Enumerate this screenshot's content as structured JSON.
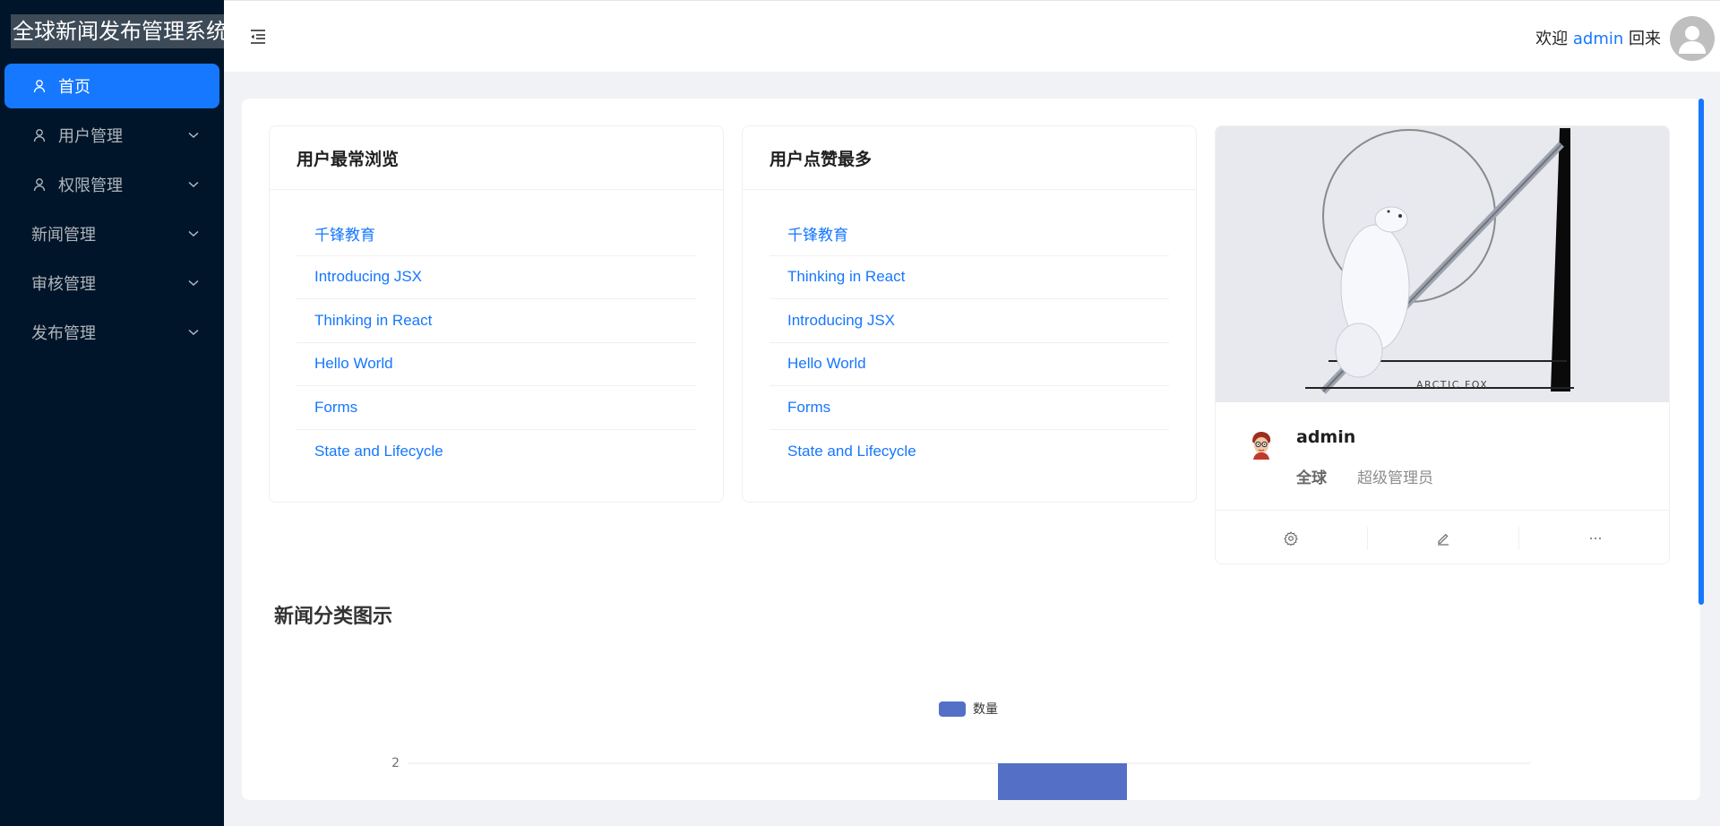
{
  "app": {
    "title": "全球新闻发布管理系统"
  },
  "sidebar": {
    "items": [
      {
        "label": "首页",
        "icon": "user-icon",
        "active": true,
        "has_arrow": false
      },
      {
        "label": "用户管理",
        "icon": "user-icon",
        "active": false,
        "has_arrow": true
      },
      {
        "label": "权限管理",
        "icon": "user-icon",
        "active": false,
        "has_arrow": true
      },
      {
        "label": "新闻管理",
        "icon": null,
        "active": false,
        "has_arrow": true
      },
      {
        "label": "审核管理",
        "icon": null,
        "active": false,
        "has_arrow": true
      },
      {
        "label": "发布管理",
        "icon": null,
        "active": false,
        "has_arrow": true
      }
    ]
  },
  "header": {
    "welcome_prefix": "欢迎",
    "username": "admin",
    "welcome_suffix": "回来"
  },
  "most_viewed": {
    "title": "用户最常浏览",
    "items": [
      "千锋教育",
      "Introducing JSX",
      "Thinking in React",
      "Hello World",
      "Forms",
      "State and Lifecycle"
    ]
  },
  "most_liked": {
    "title": "用户点赞最多",
    "items": [
      "千锋教育",
      "Thinking in React",
      "Introducing JSX",
      "Hello World",
      "Forms",
      "State and Lifecycle"
    ]
  },
  "profile": {
    "cover_text": "ARCTIC FOX",
    "name": "admin",
    "region": "全球",
    "role": "超级管理员",
    "actions": [
      "setting-icon",
      "edit-icon",
      "ellipsis-icon"
    ]
  },
  "chart": {
    "title": "新闻分类图示"
  },
  "chart_data": {
    "type": "bar",
    "legend": [
      "数量"
    ],
    "legend_position": "top-center",
    "series": [
      {
        "name": "数量",
        "color": "#5470c6"
      }
    ],
    "y_ticks": [
      "2"
    ],
    "visible_bar_value": 2,
    "note_visible": "only the top of the chart is visible; one bar reaches the value 2"
  },
  "colors": {
    "primary": "#1677ff",
    "sidebar_bg": "#001529",
    "bar": "#5470c6"
  }
}
